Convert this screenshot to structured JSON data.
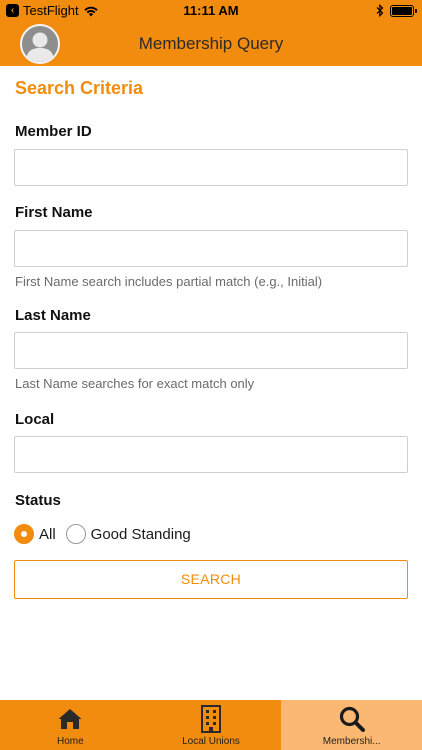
{
  "status_bar": {
    "carrier": "TestFlight",
    "time": "11:11 AM"
  },
  "nav": {
    "title": "Membership Query"
  },
  "form": {
    "section_title": "Search Criteria",
    "member_id": {
      "label": "Member ID",
      "value": ""
    },
    "first_name": {
      "label": "First Name",
      "value": "",
      "hint": "First Name search includes partial match (e.g., Initial)"
    },
    "last_name": {
      "label": "Last Name",
      "value": "",
      "hint": "Last Name searches for exact match only"
    },
    "local": {
      "label": "Local",
      "value": ""
    },
    "status": {
      "label": "Status",
      "options": [
        {
          "label": "All",
          "selected": true
        },
        {
          "label": "Good Standing",
          "selected": false
        }
      ]
    },
    "search_label": "SEARCH"
  },
  "tabs": [
    {
      "label": "Home",
      "icon": "home-icon",
      "active": false
    },
    {
      "label": "Local Unions",
      "icon": "building-icon",
      "active": false
    },
    {
      "label": "Membershi...",
      "icon": "search-icon",
      "active": true
    }
  ],
  "colors": {
    "accent": "#f28c0f",
    "active_tab": "#fbb873"
  }
}
